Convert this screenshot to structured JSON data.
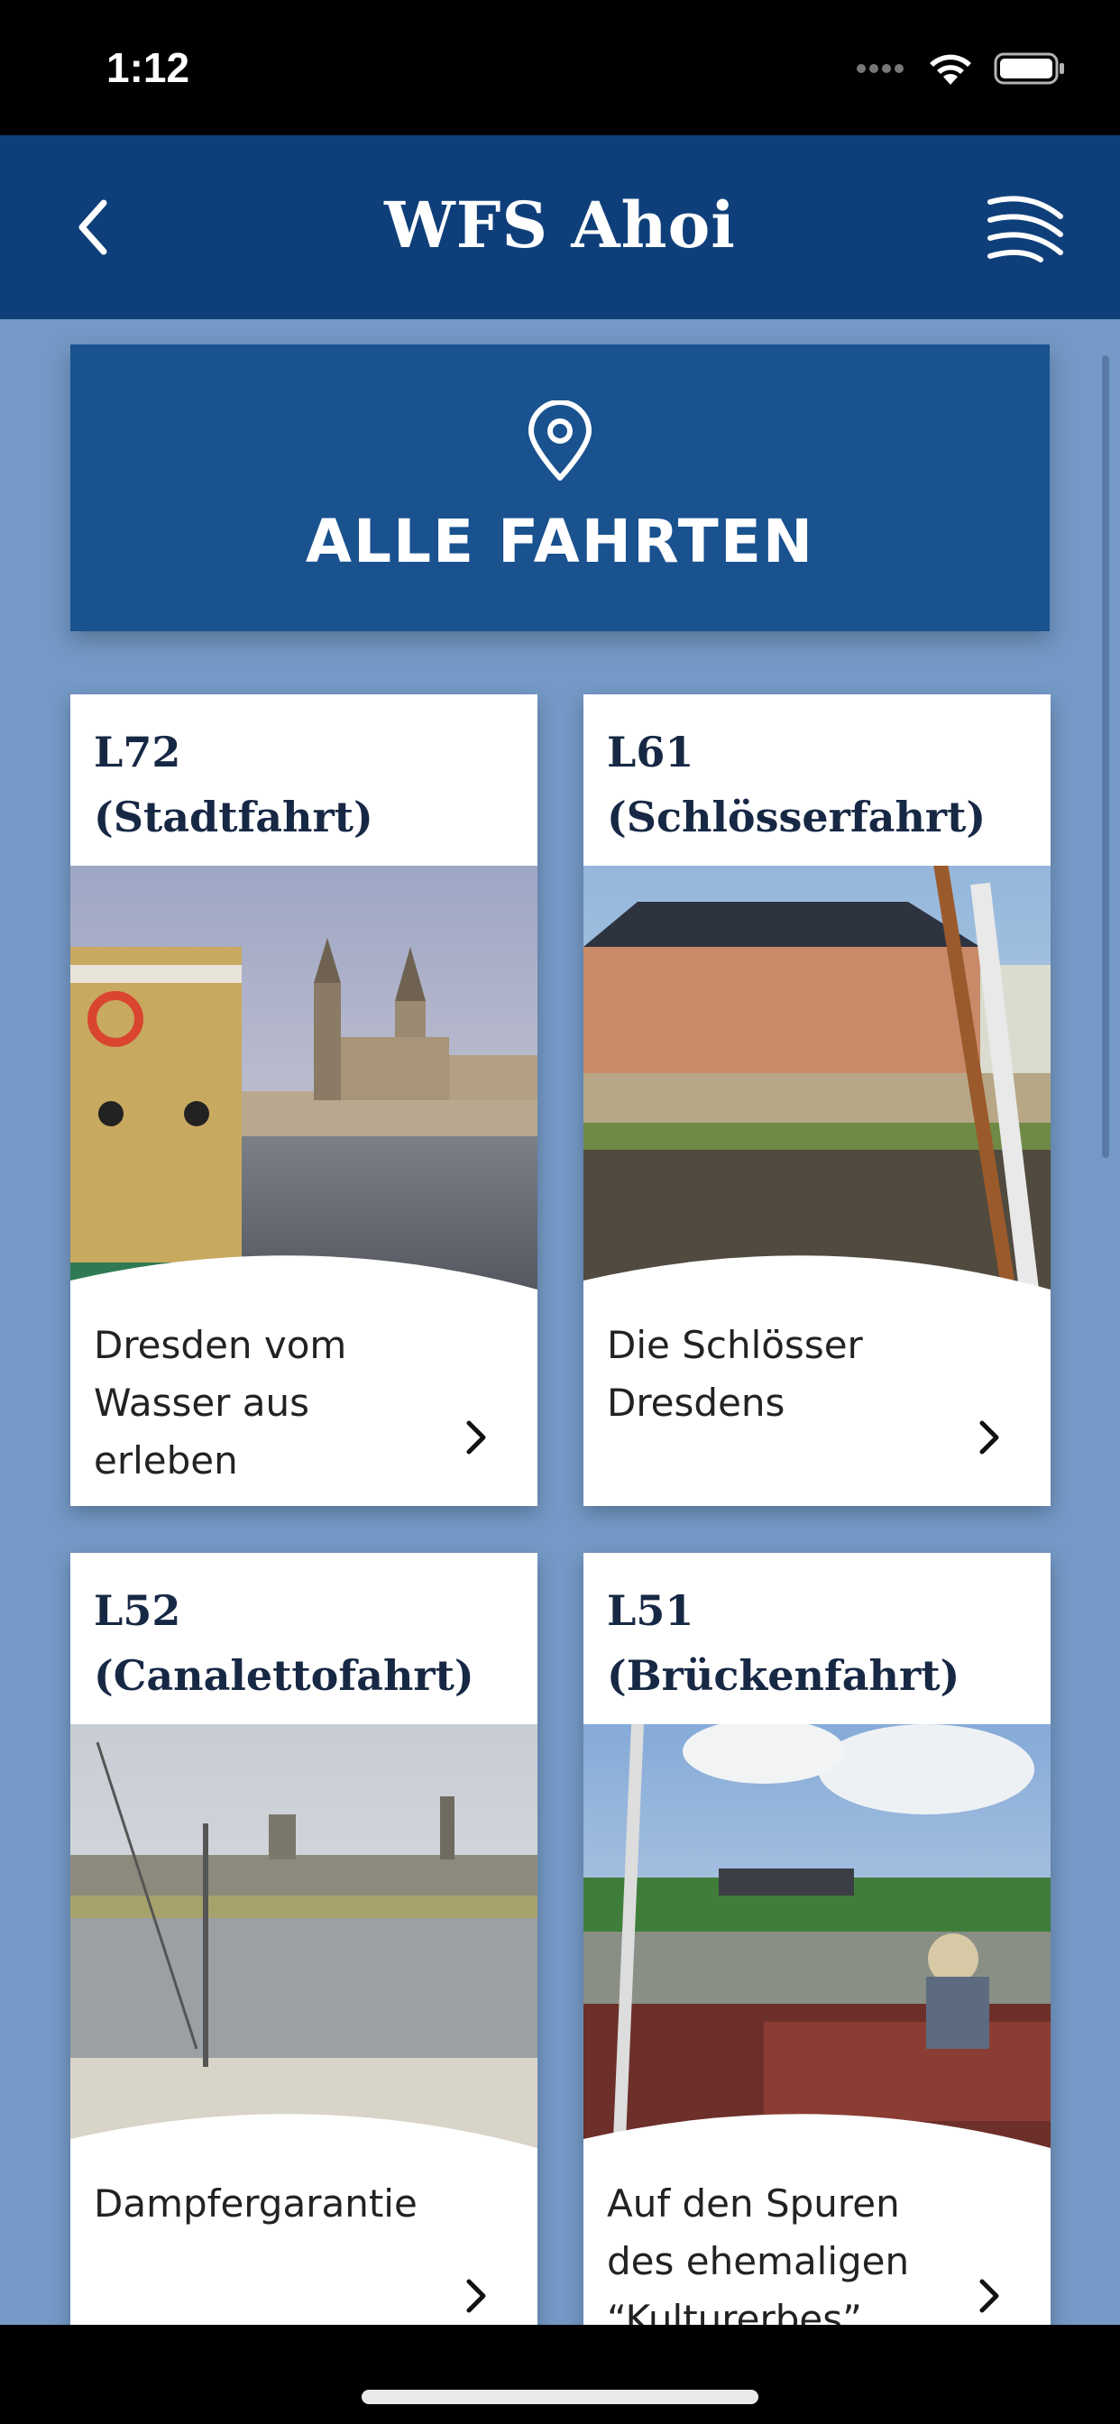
{
  "status": {
    "time": "1:12"
  },
  "nav": {
    "title": "WFS Ahoi"
  },
  "all_trips": {
    "label": "ALLE FAHRTEN"
  },
  "cards": [
    {
      "title": "L72\n(Stadtfahrt)",
      "description": "Dresden vom Wasser aus erleben"
    },
    {
      "title": "L61\n(Schlösserfahrt)",
      "description": "Die Schlösser Dresdens"
    },
    {
      "title": "L52\n(Canalettofahrt)",
      "description": "Dampfergarantie"
    },
    {
      "title": "L51\n(Brückenfahrt)",
      "description": "Auf den Spuren des ehemaligen “Kulturerbes”"
    }
  ],
  "colors": {
    "nav": "#0f3f7a",
    "accent": "#19528f",
    "background": "#7499c6"
  }
}
